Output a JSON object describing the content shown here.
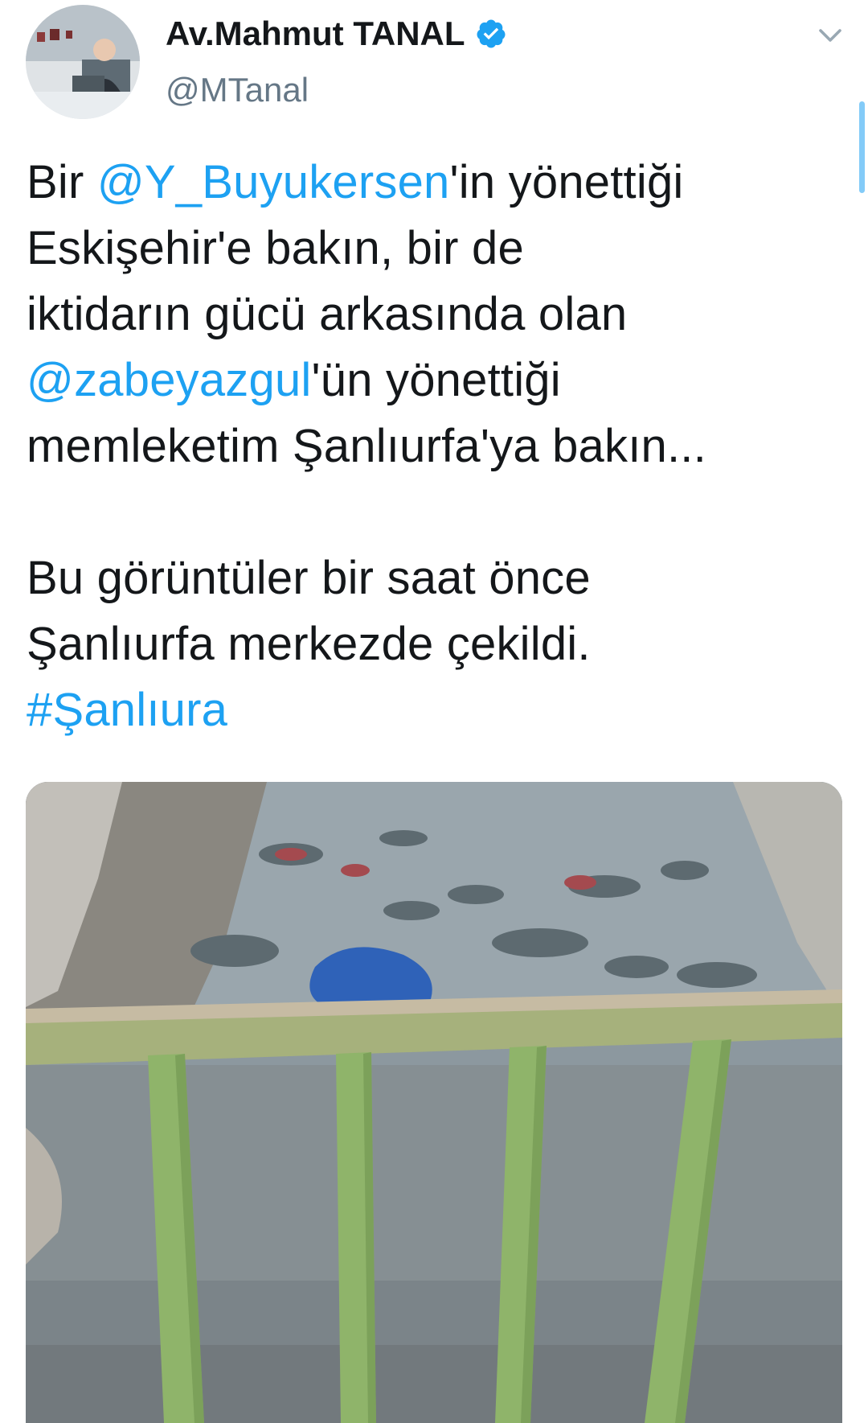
{
  "header": {
    "display_name": "Av.Mahmut TANAL",
    "handle": "@MTanal",
    "verified": true,
    "avatar_icon": "profile-photo",
    "menu_icon": "chevron-down-icon"
  },
  "tweet": {
    "lines": [
      [
        "Bir ",
        "@Y_Buyukersen",
        "'in yönettiği"
      ],
      [
        "Eskişehir'e bakın, bir de"
      ],
      [
        "iktidarın gücü arkasında olan"
      ],
      [
        "@zabeyazgul",
        "'ün yönettiği"
      ],
      [
        "memleketim Şanlıurfa'ya bakın..."
      ],
      [
        "Bu görüntüler bir saat önce"
      ],
      [
        "Şanlıurfa merkezde çekildi."
      ],
      [
        "#Şanlıura"
      ]
    ],
    "mentions": [
      "@Y_Buyukersen",
      "@zabeyazgul"
    ],
    "hashtags": [
      "#Şanlıura"
    ]
  },
  "colors": {
    "accent": "#1da1f2",
    "text": "#14171a",
    "secondary_text": "#657786",
    "rail_green": "#8fb46a"
  }
}
